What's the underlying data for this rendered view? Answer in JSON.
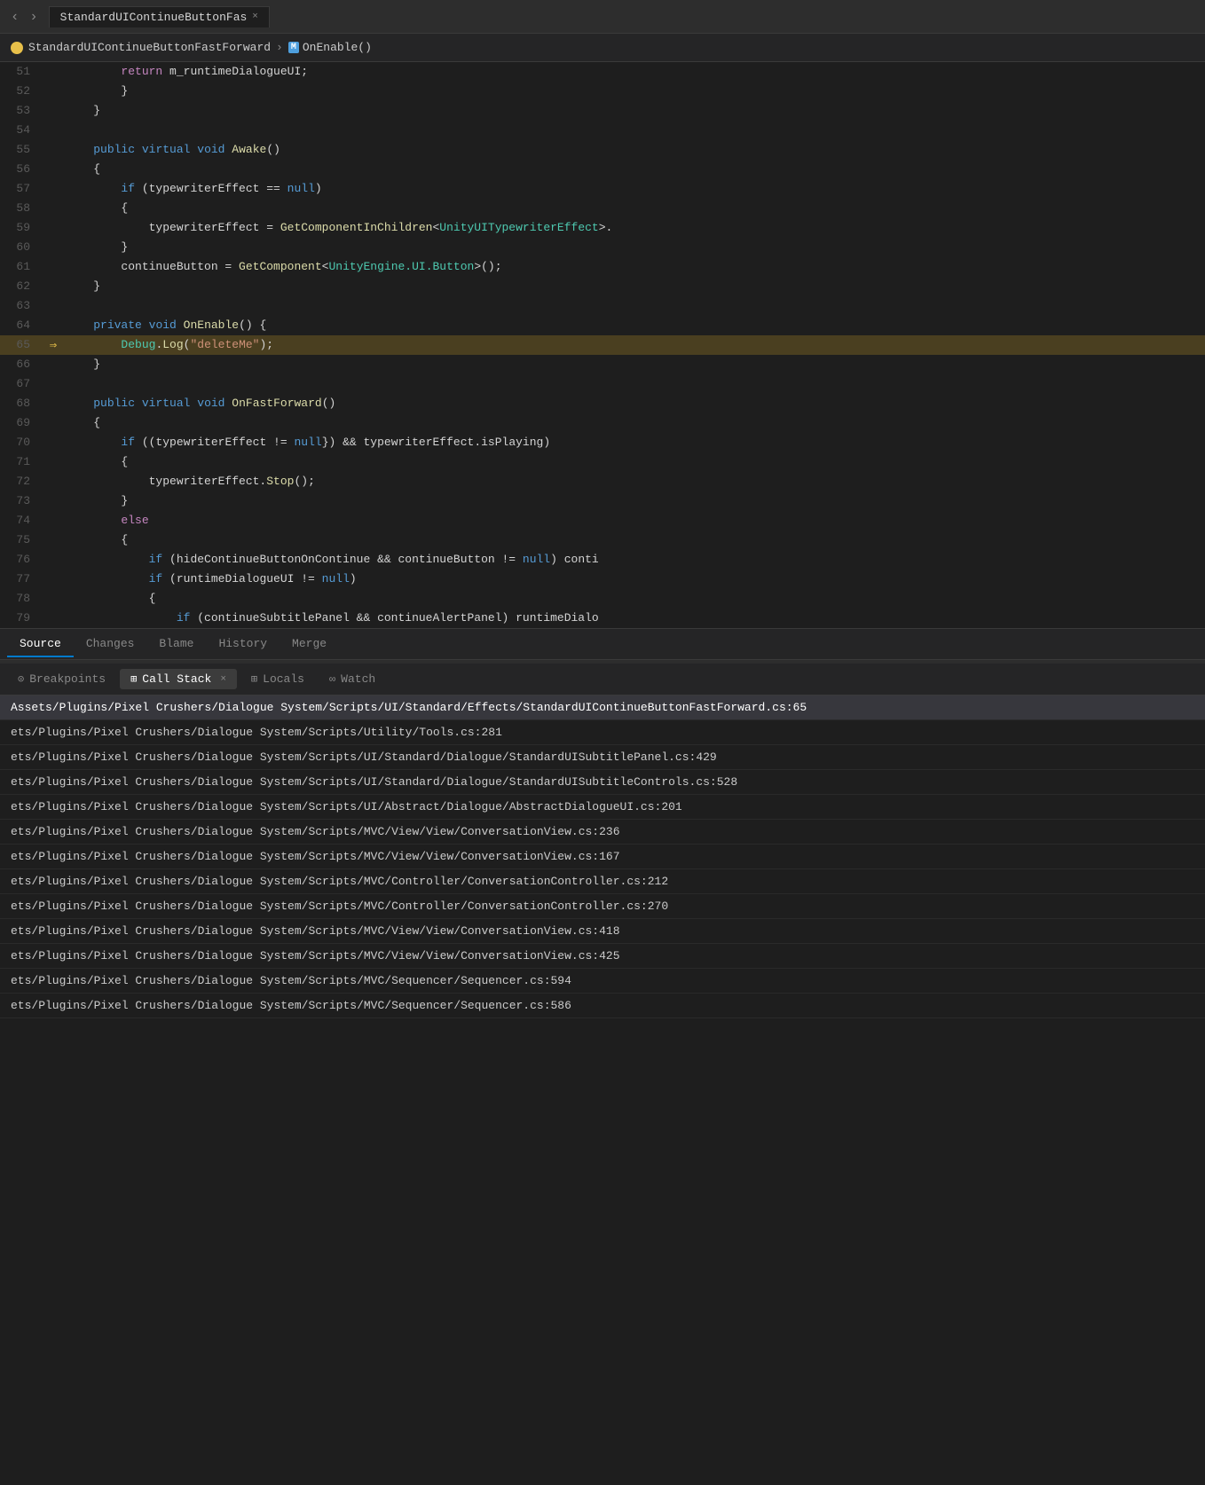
{
  "titleBar": {
    "navBack": "‹",
    "navForward": "›",
    "fileTab": {
      "name": "StandardUIContinueButtonFas",
      "closeLabel": "×"
    }
  },
  "breadcrumb": {
    "className": "StandardUIContinueButtonFastForward",
    "separator": "›",
    "methodIcon": "M",
    "methodName": "OnEnable()"
  },
  "codeLines": [
    {
      "num": 51,
      "indent": 2,
      "tokens": [
        {
          "t": "kw2",
          "v": "return"
        },
        {
          "t": "plain",
          "v": " m_runtimeDialogueUI;"
        }
      ]
    },
    {
      "num": 52,
      "indent": 2,
      "tokens": [
        {
          "t": "plain",
          "v": "}"
        }
      ]
    },
    {
      "num": 53,
      "indent": 1,
      "tokens": [
        {
          "t": "plain",
          "v": "}"
        }
      ]
    },
    {
      "num": 54,
      "indent": 0,
      "tokens": []
    },
    {
      "num": 55,
      "indent": 1,
      "tokens": [
        {
          "t": "kw",
          "v": "public"
        },
        {
          "t": "plain",
          "v": " "
        },
        {
          "t": "kw",
          "v": "virtual"
        },
        {
          "t": "plain",
          "v": " "
        },
        {
          "t": "kw",
          "v": "void"
        },
        {
          "t": "plain",
          "v": " "
        },
        {
          "t": "fn",
          "v": "Awake"
        },
        {
          "t": "plain",
          "v": "()"
        }
      ]
    },
    {
      "num": 56,
      "indent": 1,
      "tokens": [
        {
          "t": "plain",
          "v": "{"
        }
      ]
    },
    {
      "num": 57,
      "indent": 2,
      "tokens": [
        {
          "t": "kw",
          "v": "if"
        },
        {
          "t": "plain",
          "v": " (typewriterEffect == "
        },
        {
          "t": "kw",
          "v": "null"
        },
        {
          "t": "plain",
          "v": ")"
        }
      ]
    },
    {
      "num": 58,
      "indent": 2,
      "tokens": [
        {
          "t": "plain",
          "v": "{"
        }
      ]
    },
    {
      "num": 59,
      "indent": 3,
      "tokens": [
        {
          "t": "plain",
          "v": "typewriterEffect = "
        },
        {
          "t": "fn",
          "v": "GetComponentInChildren"
        },
        {
          "t": "plain",
          "v": "<"
        },
        {
          "t": "cls",
          "v": "UnityUITypewriterEffect"
        },
        {
          "t": "plain",
          "v": ">."
        }
      ]
    },
    {
      "num": 60,
      "indent": 2,
      "tokens": [
        {
          "t": "plain",
          "v": "}"
        }
      ]
    },
    {
      "num": 61,
      "indent": 2,
      "tokens": [
        {
          "t": "plain",
          "v": "continueButton = "
        },
        {
          "t": "fn",
          "v": "GetComponent"
        },
        {
          "t": "plain",
          "v": "<"
        },
        {
          "t": "cls",
          "v": "UnityEngine.UI.Button"
        },
        {
          "t": "plain",
          "v": ">();"
        }
      ]
    },
    {
      "num": 62,
      "indent": 1,
      "tokens": [
        {
          "t": "plain",
          "v": "}"
        }
      ]
    },
    {
      "num": 63,
      "indent": 0,
      "tokens": []
    },
    {
      "num": 64,
      "indent": 1,
      "tokens": [
        {
          "t": "kw",
          "v": "private"
        },
        {
          "t": "plain",
          "v": " "
        },
        {
          "t": "kw",
          "v": "void"
        },
        {
          "t": "plain",
          "v": " "
        },
        {
          "t": "fn",
          "v": "OnEnable"
        },
        {
          "t": "plain",
          "v": "() {"
        }
      ]
    },
    {
      "num": 65,
      "indent": 2,
      "highlight": true,
      "tokens": [
        {
          "t": "dbg",
          "v": "Debug"
        },
        {
          "t": "plain",
          "v": "."
        },
        {
          "t": "log",
          "v": "Log"
        },
        {
          "t": "plain",
          "v": "("
        },
        {
          "t": "str",
          "v": "\"deleteMe\""
        },
        {
          "t": "plain",
          "v": ");"
        }
      ]
    },
    {
      "num": 66,
      "indent": 1,
      "tokens": [
        {
          "t": "plain",
          "v": "}"
        }
      ]
    },
    {
      "num": 67,
      "indent": 0,
      "tokens": []
    },
    {
      "num": 68,
      "indent": 1,
      "tokens": [
        {
          "t": "kw",
          "v": "public"
        },
        {
          "t": "plain",
          "v": " "
        },
        {
          "t": "kw",
          "v": "virtual"
        },
        {
          "t": "plain",
          "v": " "
        },
        {
          "t": "kw",
          "v": "void"
        },
        {
          "t": "plain",
          "v": " "
        },
        {
          "t": "fn",
          "v": "OnFastForward"
        },
        {
          "t": "plain",
          "v": "()"
        }
      ]
    },
    {
      "num": 69,
      "indent": 1,
      "tokens": [
        {
          "t": "plain",
          "v": "{"
        }
      ]
    },
    {
      "num": 70,
      "indent": 2,
      "tokens": [
        {
          "t": "kw",
          "v": "if"
        },
        {
          "t": "plain",
          "v": " ((typewriterEffect != "
        },
        {
          "t": "kw",
          "v": "null"
        },
        {
          "t": "plain",
          "v": "}) && typewriterEffect.isPlaying)"
        }
      ]
    },
    {
      "num": 71,
      "indent": 2,
      "tokens": [
        {
          "t": "plain",
          "v": "{"
        }
      ]
    },
    {
      "num": 72,
      "indent": 3,
      "tokens": [
        {
          "t": "plain",
          "v": "typewriterEffect."
        },
        {
          "t": "fn",
          "v": "Stop"
        },
        {
          "t": "plain",
          "v": "();"
        }
      ]
    },
    {
      "num": 73,
      "indent": 2,
      "tokens": [
        {
          "t": "plain",
          "v": "}"
        }
      ]
    },
    {
      "num": 74,
      "indent": 2,
      "tokens": [
        {
          "t": "kw2",
          "v": "else"
        }
      ]
    },
    {
      "num": 75,
      "indent": 2,
      "tokens": [
        {
          "t": "plain",
          "v": "{"
        }
      ]
    },
    {
      "num": 76,
      "indent": 3,
      "tokens": [
        {
          "t": "kw",
          "v": "if"
        },
        {
          "t": "plain",
          "v": " (hideContinueButtonOnContinue && continueButton != "
        },
        {
          "t": "kw",
          "v": "null"
        },
        {
          "t": "plain",
          "v": ") conti"
        }
      ]
    },
    {
      "num": 77,
      "indent": 3,
      "tokens": [
        {
          "t": "kw",
          "v": "if"
        },
        {
          "t": "plain",
          "v": " (runtimeDialogueUI != "
        },
        {
          "t": "kw",
          "v": "null"
        },
        {
          "t": "plain",
          "v": ")"
        }
      ]
    },
    {
      "num": 78,
      "indent": 3,
      "tokens": [
        {
          "t": "plain",
          "v": "{"
        }
      ]
    },
    {
      "num": 79,
      "indent": 4,
      "tokens": [
        {
          "t": "kw",
          "v": "if"
        },
        {
          "t": "plain",
          "v": " (continueSubtitlePanel && continueAlertPanel) runtimeDialo"
        }
      ]
    }
  ],
  "bottomTabs": [
    {
      "id": "source",
      "label": "Source",
      "active": true
    },
    {
      "id": "changes",
      "label": "Changes",
      "active": false
    },
    {
      "id": "blame",
      "label": "Blame",
      "active": false
    },
    {
      "id": "history",
      "label": "History",
      "active": false
    },
    {
      "id": "merge",
      "label": "Merge",
      "active": false
    }
  ],
  "debugTabs": [
    {
      "id": "breakpoints",
      "label": "Breakpoints",
      "icon": "⊙",
      "active": false,
      "closeable": false
    },
    {
      "id": "callstack",
      "label": "Call Stack",
      "icon": "⊞",
      "active": true,
      "closeable": true
    },
    {
      "id": "locals",
      "label": "Locals",
      "icon": "⊞",
      "active": false,
      "closeable": false
    },
    {
      "id": "watch",
      "label": "Watch",
      "icon": "∞",
      "active": false,
      "closeable": false
    }
  ],
  "callStack": [
    {
      "path": "Assets/Plugins/Pixel Crushers/Dialogue System/Scripts/UI/Standard/Effects/StandardUIContinueButtonFastForward.cs:65",
      "bold": true
    },
    {
      "path": "ets/Plugins/Pixel Crushers/Dialogue System/Scripts/Utility/Tools.cs:281",
      "bold": false
    },
    {
      "path": "ets/Plugins/Pixel Crushers/Dialogue System/Scripts/UI/Standard/Dialogue/StandardUISubtitlePanel.cs:429",
      "bold": false
    },
    {
      "path": "ets/Plugins/Pixel Crushers/Dialogue System/Scripts/UI/Standard/Dialogue/StandardUISubtitleControls.cs:528",
      "bold": false
    },
    {
      "path": "ets/Plugins/Pixel Crushers/Dialogue System/Scripts/UI/Abstract/Dialogue/AbstractDialogueUI.cs:201",
      "bold": false
    },
    {
      "path": "ets/Plugins/Pixel Crushers/Dialogue System/Scripts/MVC/View/View/ConversationView.cs:236",
      "bold": false
    },
    {
      "path": "ets/Plugins/Pixel Crushers/Dialogue System/Scripts/MVC/View/View/ConversationView.cs:167",
      "bold": false
    },
    {
      "path": "ets/Plugins/Pixel Crushers/Dialogue System/Scripts/MVC/Controller/ConversationController.cs:212",
      "bold": false
    },
    {
      "path": "ets/Plugins/Pixel Crushers/Dialogue System/Scripts/MVC/Controller/ConversationController.cs:270",
      "bold": false
    },
    {
      "path": "ets/Plugins/Pixel Crushers/Dialogue System/Scripts/MVC/View/View/ConversationView.cs:418",
      "bold": false
    },
    {
      "path": "ets/Plugins/Pixel Crushers/Dialogue System/Scripts/MVC/View/View/ConversationView.cs:425",
      "bold": false
    },
    {
      "path": "ets/Plugins/Pixel Crushers/Dialogue System/Scripts/MVC/Sequencer/Sequencer.cs:594",
      "bold": false
    },
    {
      "path": "ets/Plugins/Pixel Crushers/Dialogue System/Scripts/MVC/Sequencer/Sequencer.cs:586",
      "bold": false
    }
  ]
}
